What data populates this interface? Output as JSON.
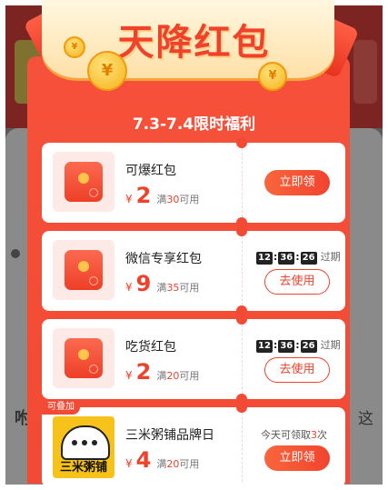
{
  "header": {
    "title": "天降红包",
    "subtitle": "7.3-7.4限时福利",
    "coin_symbol": "¥"
  },
  "background": {
    "left_text": "咐",
    "right_text": "这"
  },
  "currency": "¥",
  "coupons": [
    {
      "title": "可爆红包",
      "amount": "2",
      "cond_prefix": "满",
      "cond_value": "30",
      "cond_suffix": "可用",
      "action": "立即领",
      "action_style": "solid",
      "thumb_icon": "red-envelope-icon"
    },
    {
      "title": "微信专享红包",
      "amount": "9",
      "cond_prefix": "满",
      "cond_value": "35",
      "cond_suffix": "可用",
      "action": "去使用",
      "action_style": "outline",
      "thumb_icon": "red-envelope-icon",
      "countdown": {
        "h": "12",
        "m": "36",
        "s": "26",
        "label": "过期"
      }
    },
    {
      "title": "吃货红包",
      "amount": "2",
      "cond_prefix": "满",
      "cond_value": "20",
      "cond_suffix": "可用",
      "action": "去使用",
      "action_style": "outline",
      "thumb_icon": "red-envelope-icon",
      "countdown": {
        "h": "12",
        "m": "36",
        "s": "26",
        "label": "过期"
      }
    },
    {
      "title": "三米粥铺品牌日",
      "amount": "4",
      "cond_prefix": "满",
      "cond_value": "20",
      "cond_suffix": "可用",
      "action": "立即领",
      "action_style": "solid",
      "thumb_icon": "sanmi-congee-logo",
      "badge": "可叠加",
      "logo_text": "三米粥铺",
      "claim_prefix": "今天可领取",
      "claim_count": "3",
      "claim_suffix": "次"
    }
  ],
  "colors": {
    "primary_red": "#f24a34",
    "accent_red": "#f0412b",
    "coin_gold": "#f6b21a",
    "logo_yellow": "#f7c21a"
  }
}
